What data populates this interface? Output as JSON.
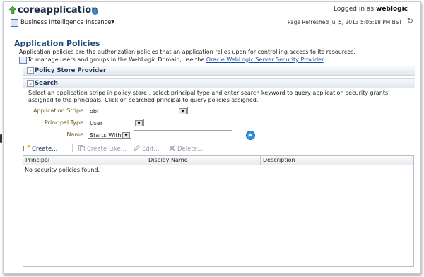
{
  "header": {
    "title": "coreapplication",
    "instance_label": "Business Intelligence Instance",
    "logged_in_prefix": "Logged in as",
    "user": "weblogic",
    "page_refreshed": "Page Refreshed Jul 5, 2013 5:05:18 PM BST"
  },
  "policies": {
    "title": "Application Policies",
    "description": "Application policies are the authorization policies that an application relies upon for controlling access to its resources.",
    "manage_prefix": "To manage users and groups in the WebLogic Domain, use the",
    "manage_link": "Oracle WebLogic Server Security Provider",
    "manage_suffix": "."
  },
  "sections": {
    "policy_store": "Policy Store Provider",
    "search": "Search"
  },
  "search": {
    "help": "Select an application stripe in policy store , select principal type and enter search keyword to query application security grants assigned to the principals. Click on searched principal to query policies assigned.",
    "stripe_label": "Application Stripe",
    "stripe_value": "obi",
    "principal_label": "Principal Type",
    "principal_value": "User",
    "name_label": "Name",
    "name_operator": "Starts With",
    "name_value": ""
  },
  "toolbar": {
    "create": "Create...",
    "create_like": "Create Like...",
    "edit": "Edit...",
    "delete": "Delete..."
  },
  "table": {
    "columns": [
      "Principal",
      "Display Name",
      "Description"
    ],
    "empty_message": "No security policies found."
  },
  "colors": {
    "title": "#1f4a7a",
    "link": "#1a4fa0",
    "field_label": "#6b5a1a"
  }
}
